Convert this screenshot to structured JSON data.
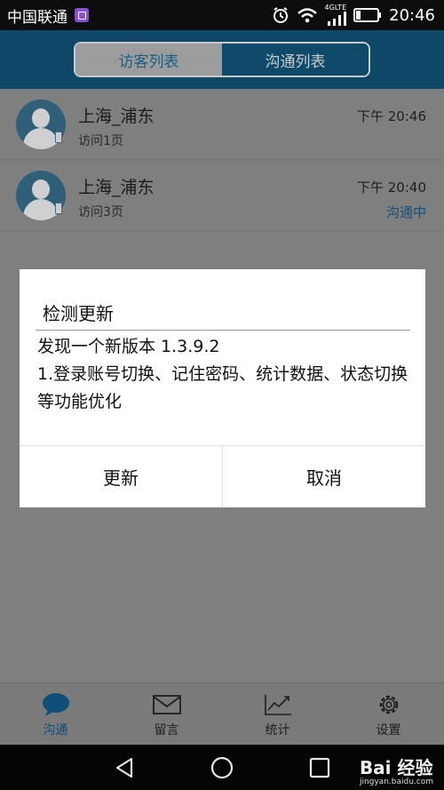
{
  "status_bar": {
    "carrier": "中国联通",
    "network_label": "4GLTE",
    "time": "20:46",
    "icons": [
      "app-badge-icon",
      "alarm-icon",
      "wifi-icon",
      "signal-icon",
      "battery-icon"
    ]
  },
  "header": {
    "tabs": [
      {
        "label": "访客列表",
        "selected": true
      },
      {
        "label": "沟通列表",
        "selected": false
      }
    ]
  },
  "visitors": [
    {
      "title": "上海_浦东",
      "subtitle": "访问1页",
      "time": "下午 20:46",
      "status": ""
    },
    {
      "title": "上海_浦东",
      "subtitle": "访问3页",
      "time": "下午 20:40",
      "status": "沟通中"
    }
  ],
  "dialog": {
    "title": "检测更新",
    "message_line1": "发现一个新版本 1.3.9.2",
    "message_line2": "1.登录账号切换、记住密码、统计数据、状态切换等功能优化",
    "update_label": "更新",
    "cancel_label": "取消"
  },
  "bottom_tabs": [
    {
      "label": "沟通",
      "icon": "chat-bubble-icon",
      "active": true
    },
    {
      "label": "留言",
      "icon": "envelope-icon",
      "active": false
    },
    {
      "label": "统计",
      "icon": "trend-chart-icon",
      "active": false
    },
    {
      "label": "设置",
      "icon": "gear-icon",
      "active": false
    }
  ],
  "watermark": {
    "main": "Bai 经验",
    "sub": "jingyan.baidu.com"
  },
  "colors": {
    "accent": "#1a8fcf",
    "dim_overlay": "#7f7f7f"
  }
}
